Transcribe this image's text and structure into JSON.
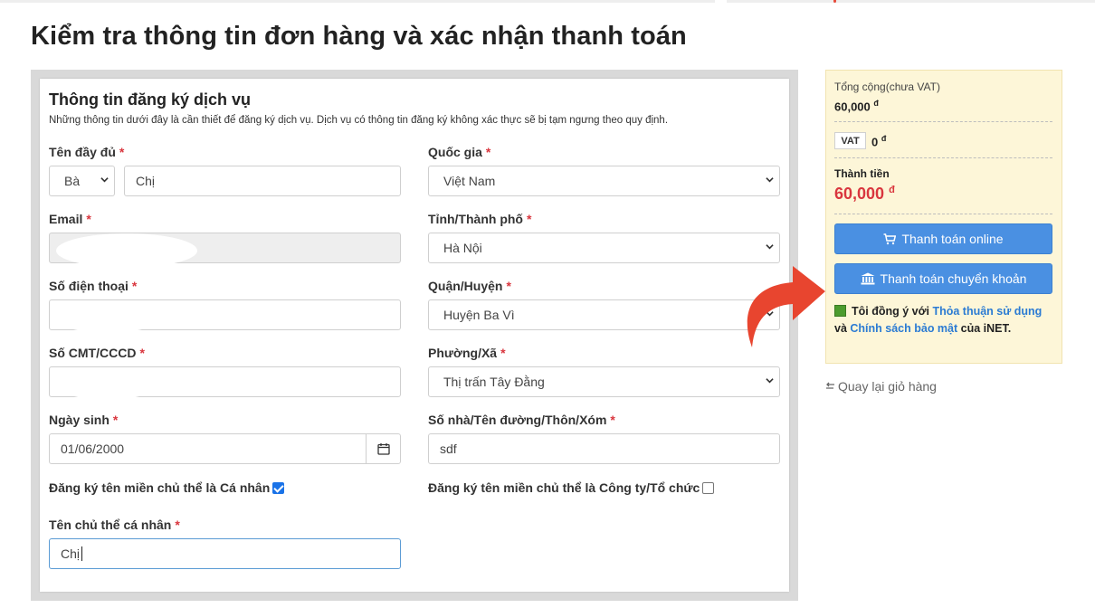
{
  "page": {
    "title": "Kiểm tra thông tin đơn hàng và xác nhận thanh toán"
  },
  "form": {
    "title": "Thông tin đăng ký dịch vụ",
    "description": "Những thông tin dưới đây là cần thiết để đăng ký dịch vụ. Dịch vụ có thông tin đăng ký không xác thực sẽ bị tạm ngưng theo quy định.",
    "required_mark": "*",
    "fullname": {
      "label": "Tên đầy đủ",
      "title_value": "Bà",
      "name_value": "Chị"
    },
    "email": {
      "label": "Email",
      "value": ""
    },
    "phone": {
      "label": "Số điện thoại",
      "value": ""
    },
    "id_card": {
      "label": "Số CMT/CCCD",
      "value": ""
    },
    "birthday": {
      "label": "Ngày sinh",
      "value": "01/06/2000"
    },
    "personal_domain": {
      "label": "Đăng ký tên miền chủ thể là Cá nhân",
      "checked": true
    },
    "owner_name": {
      "label": "Tên chủ thể cá nhân",
      "value": "Chị"
    },
    "country": {
      "label": "Quốc gia",
      "value": "Việt Nam"
    },
    "province": {
      "label": "Tỉnh/Thành phố",
      "value": "Hà Nội"
    },
    "district": {
      "label": "Quận/Huyện",
      "value": "Huyện Ba Vì"
    },
    "ward": {
      "label": "Phường/Xã",
      "value": "Thị trấn Tây Đằng"
    },
    "street": {
      "label": "Số nhà/Tên đường/Thôn/Xóm",
      "value": "sdf"
    },
    "company_domain": {
      "label": "Đăng ký tên miền chủ thể là Công ty/Tổ chức",
      "checked": false
    }
  },
  "summary": {
    "subtotal_label": "Tổng cộng(chưa VAT)",
    "subtotal_value": "60,000",
    "currency": "đ",
    "vat_label": "VAT",
    "vat_value": "0",
    "total_label": "Thành tiền",
    "total_value": "60,000",
    "pay_online_label": "Thanh toán online",
    "pay_transfer_label": "Thanh toán chuyển khoản",
    "agree_prefix": "Tôi đồng ý với",
    "agree_link1": "Thỏa thuận sử dụng",
    "agree_and": "và",
    "agree_link2": "Chính sách bảo mật",
    "agree_suffix": "của iNET.",
    "back_label": "Quay lại giỏ hàng"
  },
  "colors": {
    "accent_blue": "#4a90e2",
    "required_red": "#d9363e",
    "summary_bg": "#fdf6d8",
    "annotation_arrow": "#e8452f"
  },
  "icons": {
    "cart": "cart-icon",
    "bank": "bank-icon",
    "calendar": "calendar-icon",
    "back": "return-icon",
    "chevron": "chevron-down-icon"
  }
}
